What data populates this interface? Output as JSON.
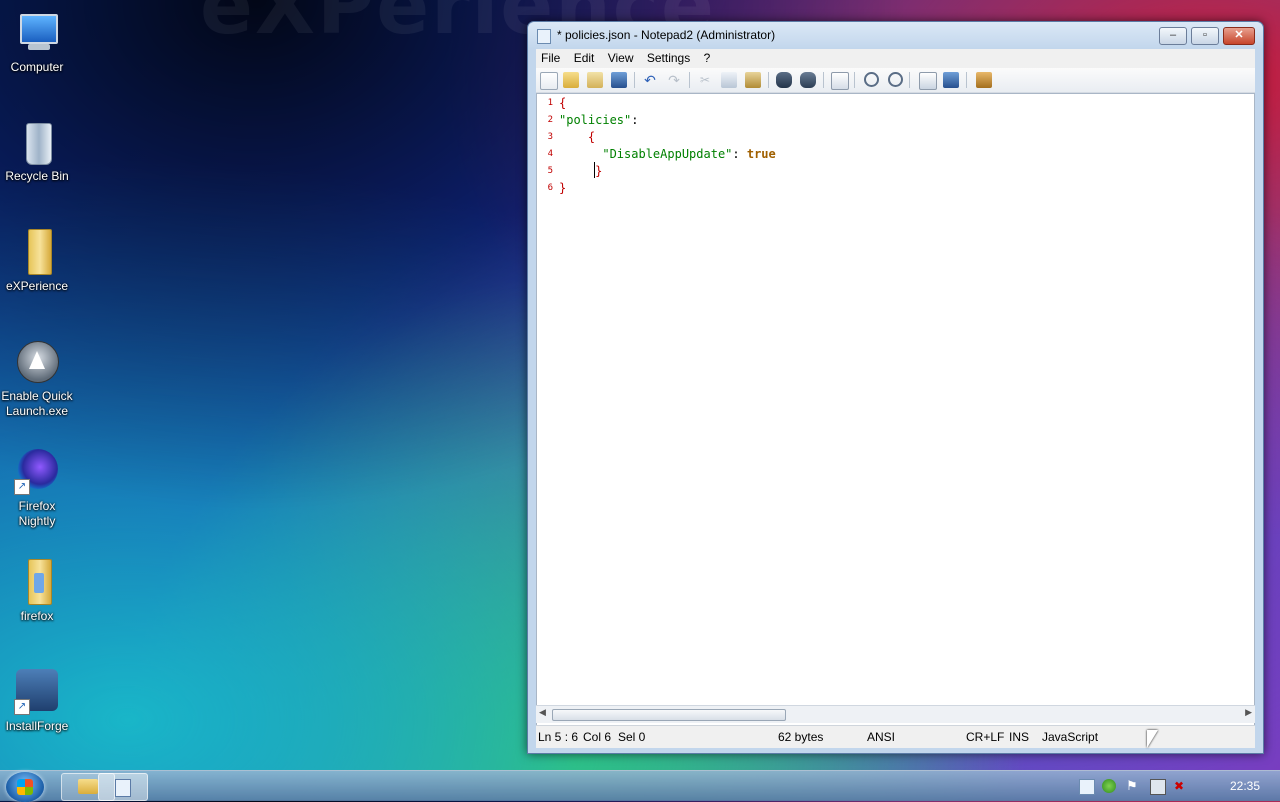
{
  "desktop": {
    "watermark": "eXPerience",
    "icons": [
      {
        "label": "Computer"
      },
      {
        "label": "Recycle Bin"
      },
      {
        "label": "eXPerience"
      },
      {
        "label": "Enable Quick Launch.exe"
      },
      {
        "label": "Firefox Nightly"
      },
      {
        "label": "firefox"
      },
      {
        "label": "InstallForge"
      }
    ]
  },
  "window": {
    "title": "* policies.json - Notepad2 (Administrator)",
    "menu": [
      "File",
      "Edit",
      "View",
      "Settings",
      "?"
    ],
    "editor": {
      "line_numbers": [
        "1",
        "2",
        "3",
        "4",
        "5",
        "6"
      ],
      "lines": [
        {
          "segments": [
            {
              "text": "{",
              "color": "#c00000"
            }
          ]
        },
        {
          "segments": [
            {
              "text": "\"policies\"",
              "color": "#008000"
            },
            {
              "text": ":",
              "color": "#000000"
            }
          ]
        },
        {
          "segments": [
            {
              "text": "    {",
              "color": "#c00000"
            }
          ]
        },
        {
          "segments": [
            {
              "text": "      \"DisableAppUpdate\"",
              "color": "#008000"
            },
            {
              "text": ": ",
              "color": "#000000"
            },
            {
              "text": "true",
              "color": "#a06000"
            }
          ]
        },
        {
          "segments": [
            {
              "text": "     }",
              "color": "#c00000"
            }
          ]
        },
        {
          "segments": [
            {
              "text": "}",
              "color": "#c00000"
            }
          ]
        }
      ]
    },
    "status": {
      "position": "Ln 5 : 6",
      "col": "Col 6",
      "sel": "Sel 0",
      "size": "62 bytes",
      "encoding": "ANSI",
      "eol": "CR+LF",
      "mode": "INS",
      "lexer": "JavaScript"
    }
  },
  "taskbar": {
    "clock": "22:35"
  }
}
